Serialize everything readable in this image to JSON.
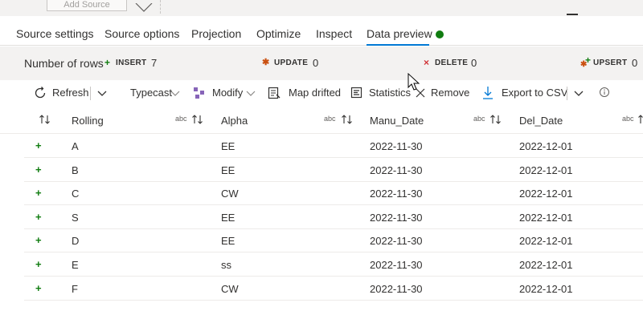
{
  "top": {
    "add_source": "Add Source"
  },
  "tabs": [
    {
      "label": "Source settings"
    },
    {
      "label": "Source options"
    },
    {
      "label": "Projection"
    },
    {
      "label": "Optimize"
    },
    {
      "label": "Inspect"
    },
    {
      "label": "Data preview"
    }
  ],
  "stats": {
    "rows_label": "Number of rows",
    "insert_label": "INSERT",
    "insert_value": "7",
    "update_label": "UPDATE",
    "update_value": "0",
    "delete_label": "DELETE",
    "delete_value": "0",
    "upsert_label": "UPSERT",
    "upsert_value": "0"
  },
  "toolbar": {
    "refresh": "Refresh",
    "typecast": "Typecast",
    "modify": "Modify",
    "map_drifted": "Map drifted",
    "statistics": "Statistics",
    "remove": "Remove",
    "export_csv": "Export to CSV"
  },
  "table": {
    "columns": [
      {
        "name": "Rolling",
        "type": "abc"
      },
      {
        "name": "Alpha",
        "type": "abc"
      },
      {
        "name": "Manu_Date",
        "type": "abc"
      },
      {
        "name": "Del_Date",
        "type": "abc"
      }
    ],
    "rows": [
      {
        "Rolling": "A",
        "Alpha": "EE",
        "Manu_Date": "2022-11-30",
        "Del_Date": "2022-12-01"
      },
      {
        "Rolling": "B",
        "Alpha": "EE",
        "Manu_Date": "2022-11-30",
        "Del_Date": "2022-12-01"
      },
      {
        "Rolling": "C",
        "Alpha": "CW",
        "Manu_Date": "2022-11-30",
        "Del_Date": "2022-12-01"
      },
      {
        "Rolling": "S",
        "Alpha": "EE",
        "Manu_Date": "2022-11-30",
        "Del_Date": "2022-12-01"
      },
      {
        "Rolling": "D",
        "Alpha": "EE",
        "Manu_Date": "2022-11-30",
        "Del_Date": "2022-12-01"
      },
      {
        "Rolling": "E",
        "Alpha": "ss",
        "Manu_Date": "2022-11-30",
        "Del_Date": "2022-12-01"
      },
      {
        "Rolling": "F",
        "Alpha": "CW",
        "Manu_Date": "2022-11-30",
        "Del_Date": "2022-12-01"
      }
    ]
  },
  "colors": {
    "accent": "#0078d4",
    "insert": "#107c10",
    "update": "#ca5010",
    "delete": "#d13438",
    "upsert": "#107c10"
  }
}
